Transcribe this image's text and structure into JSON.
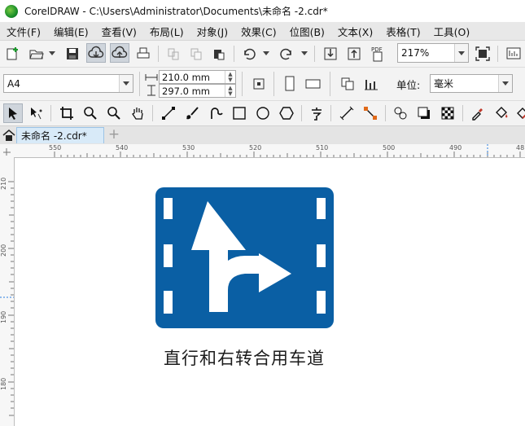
{
  "window": {
    "title": "CorelDRAW - C:\\Users\\Administrator\\Documents\\未命名 -2.cdr*"
  },
  "menu": [
    "文件(F)",
    "编辑(E)",
    "查看(V)",
    "布局(L)",
    "对象(J)",
    "效果(C)",
    "位图(B)",
    "文本(X)",
    "表格(T)",
    "工具(O)"
  ],
  "toolbar": {
    "zoom_value": "217%",
    "pdf_label": "PDF"
  },
  "property_bar": {
    "page_size": "A4",
    "width_value": "210.0 mm",
    "height_value": "297.0 mm",
    "units_label": "单位:",
    "units_value": "毫米"
  },
  "tabs": {
    "document_tab": "未命名 -2.cdr*"
  },
  "rulers": {
    "horizontal": [
      "550",
      "540",
      "530",
      "520",
      "510",
      "500",
      "490",
      "48"
    ],
    "vertical": [
      "210",
      "200",
      "190",
      "180"
    ]
  },
  "canvas": {
    "sign_caption": "直行和右转合用车道",
    "sign_color": "#0a5fa4"
  }
}
